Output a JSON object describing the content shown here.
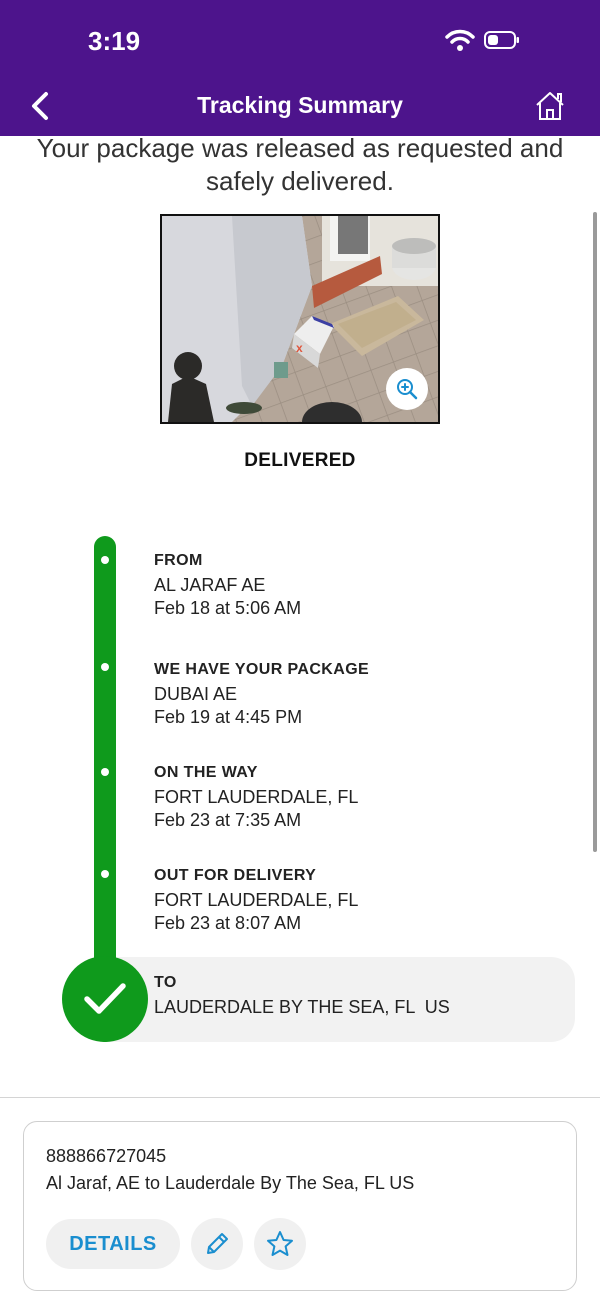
{
  "status_bar": {
    "time": "3:19"
  },
  "nav": {
    "title": "Tracking Summary"
  },
  "headline": {
    "line1": "Your package was released as requested and",
    "line2": "safely delivered."
  },
  "delivery_status": "DELIVERED",
  "timeline": [
    {
      "title": "FROM",
      "location": "AL JARAF AE",
      "time": "Feb 18 at 5:06 AM"
    },
    {
      "title": "WE HAVE YOUR PACKAGE",
      "location": "DUBAI AE",
      "time": "Feb 19 at 4:45 PM"
    },
    {
      "title": "ON THE WAY",
      "location": "FORT LAUDERDALE, FL",
      "time": "Feb 23 at 7:35 AM"
    },
    {
      "title": "OUT FOR DELIVERY",
      "location": "FORT LAUDERDALE, FL",
      "time": "Feb 23 at 8:07 AM"
    },
    {
      "title": "TO",
      "location": "LAUDERDALE BY THE SEA, FL  US"
    }
  ],
  "card": {
    "tracking_number": "888866727045",
    "route": "Al Jaraf, AE to Lauderdale By The Sea, FL US",
    "details_label": "DETAILS"
  },
  "colors": {
    "brand_purple": "#4d148c",
    "success_green": "#0f9a1c",
    "link_blue": "#1a8ecf"
  },
  "icons": [
    "back-chevron-icon",
    "home-icon",
    "zoom-in-icon",
    "checkmark-icon",
    "pencil-icon",
    "star-icon",
    "wifi-icon",
    "battery-icon"
  ]
}
